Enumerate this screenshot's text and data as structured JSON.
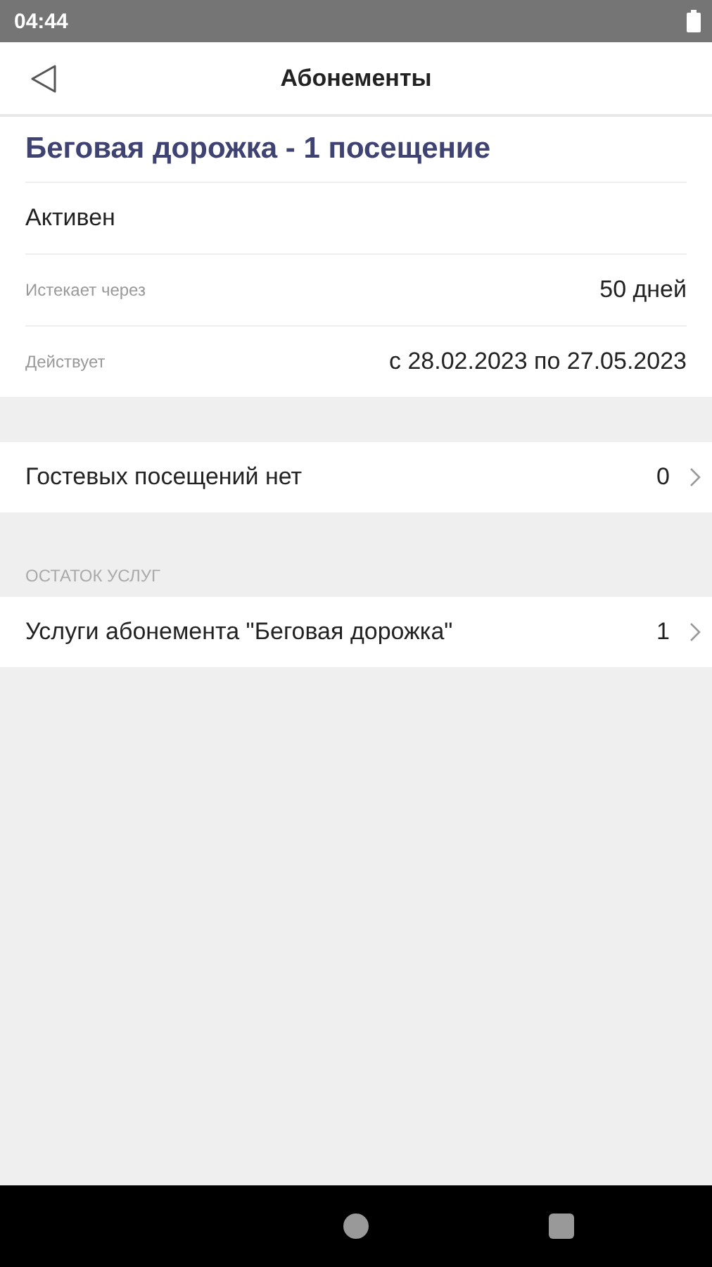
{
  "status_bar": {
    "time": "04:44"
  },
  "header": {
    "title": "Абонементы"
  },
  "subscription": {
    "title": "Беговая дорожка - 1 посещение",
    "status": "Активен",
    "details": [
      {
        "label": "Истекает через",
        "value": "50 дней"
      },
      {
        "label": "Действует",
        "value": "с 28.02.2023 по 27.05.2023"
      }
    ]
  },
  "guest_row": {
    "label": "Гостевых посещений нет",
    "count": "0"
  },
  "services": {
    "heading": "ОСТАТОК УСЛУГ",
    "rows": [
      {
        "label": "Услуги абонемента \"Беговая дорожка\"",
        "count": "1"
      }
    ]
  }
}
